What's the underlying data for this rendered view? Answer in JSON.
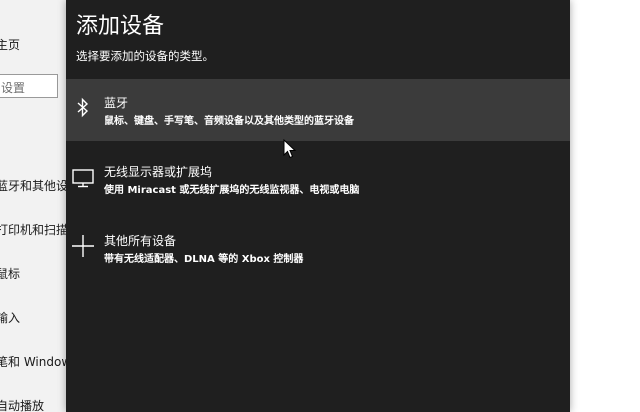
{
  "background_settings": {
    "nav": [
      {
        "label": "主页"
      },
      {
        "label": "蓝牙和其他设"
      },
      {
        "label": "打印机和扫描"
      },
      {
        "label": "鼠标"
      },
      {
        "label": "输入"
      },
      {
        "label": "笔和 Window"
      },
      {
        "label": "自动播放"
      }
    ],
    "search_placeholder": "设置"
  },
  "dialog": {
    "title": "添加设备",
    "subtitle": "选择要添加的设备的类型。",
    "options": [
      {
        "icon": "bluetooth-icon",
        "title": "蓝牙",
        "description": "鼠标、键盘、手写笔、音频设备以及其他类型的蓝牙设备"
      },
      {
        "icon": "monitor-icon",
        "title": "无线显示器或扩展坞",
        "description": "使用 Miracast 或无线扩展坞的无线监视器、电视或电脑"
      },
      {
        "icon": "plus-icon",
        "title": "其他所有设备",
        "description": "带有无线适配器、DLNA 等的 Xbox 控制器"
      }
    ]
  },
  "colors": {
    "dialog_bg": "#1f1f1f",
    "hover_bg": "#3b3b3b",
    "text": "#ffffff"
  }
}
